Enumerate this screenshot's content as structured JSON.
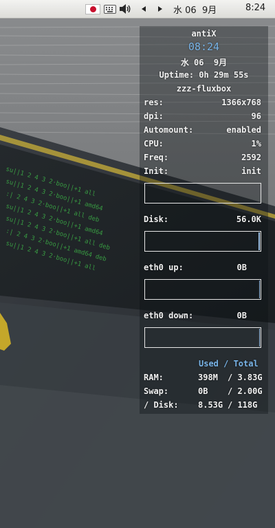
{
  "panel": {
    "flag_icon": "japan-flag-icon",
    "keyboard_icon": "keyboard-icon",
    "volume_icon": "volume-icon",
    "prev_icon": "triangle-left-icon",
    "next_icon": "triangle-right-icon",
    "date": "水 06  9月",
    "clock": "8:24"
  },
  "conky": {
    "hostname": "antiX",
    "time": "08:24",
    "date": "水 06  9月",
    "uptime": "Uptime: 0h 29m 55s",
    "window_manager": "zzz-fluxbox",
    "stats": [
      {
        "label": "res:",
        "value": "1366x768"
      },
      {
        "label": "dpi:",
        "value": "96"
      },
      {
        "label": "Automount:",
        "value": "enabled"
      },
      {
        "label": "CPU:",
        "value": "1%"
      },
      {
        "label": "Freq:",
        "value": "2592"
      },
      {
        "label": "Init:",
        "value": "init"
      }
    ],
    "disk": {
      "label": "Disk:",
      "value": "56.0K"
    },
    "eth0_up": {
      "label": "eth0 up:",
      "value": "0B"
    },
    "eth0_down": {
      "label": "eth0 down:",
      "value": "0B"
    },
    "usage_header": "Used / Total",
    "usage": [
      {
        "label": "RAM:",
        "used": "398M",
        "total": "/ 3.83G"
      },
      {
        "label": "Swap:",
        "used": "0B",
        "total": "/ 2.00G"
      },
      {
        "label": "/ Disk:",
        "used": "8.53G",
        "total": "/ 118G"
      }
    ]
  },
  "colors": {
    "accent": "#78b4e8",
    "panel_bg": "#e8e8e6",
    "conky_text": "#f0f0f0"
  }
}
